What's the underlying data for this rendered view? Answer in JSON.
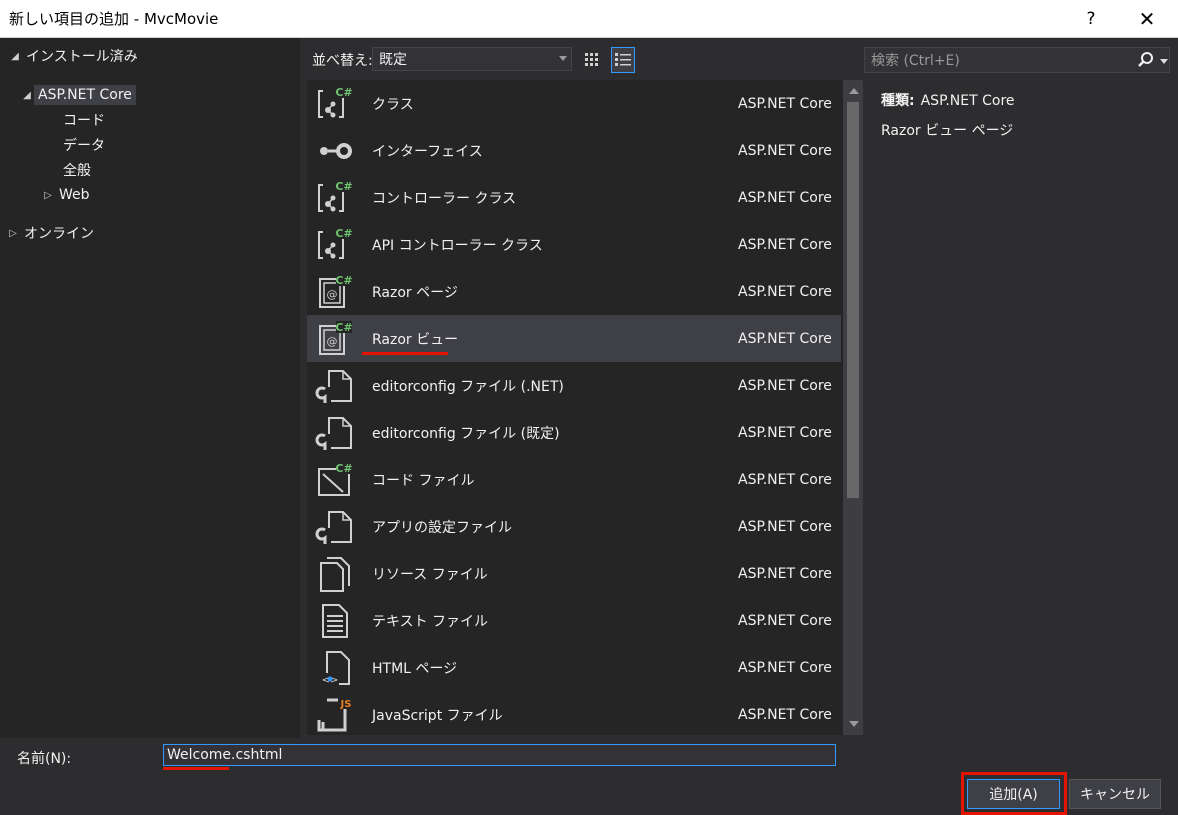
{
  "window": {
    "title": "新しい項目の追加 - MvcMovie",
    "help": "?",
    "close": "✕"
  },
  "tree": {
    "installed": "インストール済み",
    "root": "ASP.NET Core",
    "children": [
      "コード",
      "データ",
      "全般",
      "Web"
    ],
    "online": "オンライン"
  },
  "toolbar": {
    "sort_label": "並べ替え:",
    "sort_value": "既定",
    "search_placeholder": "検索 (Ctrl+E)"
  },
  "templates": [
    {
      "name": "クラス",
      "category": "ASP.NET Core",
      "icon": "class-icon"
    },
    {
      "name": "インターフェイス",
      "category": "ASP.NET Core",
      "icon": "interface-icon"
    },
    {
      "name": "コントローラー クラス",
      "category": "ASP.NET Core",
      "icon": "class-icon"
    },
    {
      "name": "API コントローラー クラス",
      "category": "ASP.NET Core",
      "icon": "class-icon"
    },
    {
      "name": "Razor ページ",
      "category": "ASP.NET Core",
      "icon": "razor-icon"
    },
    {
      "name": "Razor ビュー",
      "category": "ASP.NET Core",
      "icon": "razor-icon",
      "selected": true
    },
    {
      "name": "editorconfig ファイル (.NET)",
      "category": "ASP.NET Core",
      "icon": "config-file-icon"
    },
    {
      "name": "editorconfig ファイル (既定)",
      "category": "ASP.NET Core",
      "icon": "config-file-icon"
    },
    {
      "name": "コード ファイル",
      "category": "ASP.NET Core",
      "icon": "code-file-icon"
    },
    {
      "name": "アプリの設定ファイル",
      "category": "ASP.NET Core",
      "icon": "config-file-icon"
    },
    {
      "name": "リソース ファイル",
      "category": "ASP.NET Core",
      "icon": "resource-file-icon"
    },
    {
      "name": "テキスト ファイル",
      "category": "ASP.NET Core",
      "icon": "text-file-icon"
    },
    {
      "name": "HTML ページ",
      "category": "ASP.NET Core",
      "icon": "html-file-icon"
    },
    {
      "name": "JavaScript ファイル",
      "category": "ASP.NET Core",
      "icon": "js-file-icon"
    }
  ],
  "details": {
    "kind_label": "種類:",
    "kind_value": "ASP.NET Core",
    "description": "Razor ビュー ページ"
  },
  "form": {
    "name_label": "名前(N):",
    "name_value": "Welcome.cshtml"
  },
  "buttons": {
    "add": "追加(A)",
    "cancel": "キャンセル"
  },
  "colors": {
    "accent": "#3399ff",
    "annotation": "#e51400",
    "csharp_green": "#6fc26f",
    "js_orange": "#e67e22"
  }
}
